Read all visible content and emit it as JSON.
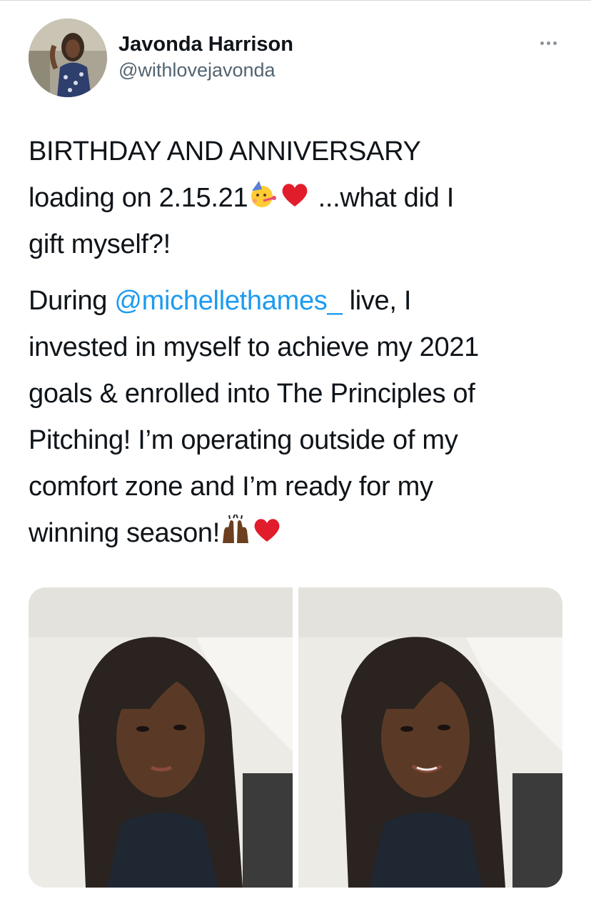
{
  "author": {
    "display_name": "Javonda Harrison",
    "handle": "@withlovejavonda",
    "avatar_icon": "profile-photo"
  },
  "more_icon": "more-options-icon",
  "tweet": {
    "line1": "BIRTHDAY AND ANNIVERSARY",
    "line2_start": "loading on 2.15.21",
    "line2_end": " ...what did I",
    "line3": "gift myself?!",
    "p2_start": "During ",
    "mention": "@michellethames_",
    "p2_after_mention": "  live, I",
    "p2_line2": "invested in myself to achieve my 2021",
    "p2_line3": "goals & enrolled into The Principles of",
    "p2_line4": "Pitching! I’m operating outside of my",
    "p2_line5": "comfort zone and I’m ready for my",
    "p2_line6": "winning season!"
  },
  "emojis": [
    "partying-face-emoji",
    "red-heart-emoji",
    "raising-hands-emoji",
    "red-heart-emoji"
  ],
  "media": [
    {
      "name": "selfie-photo-1"
    },
    {
      "name": "selfie-photo-2"
    }
  ],
  "colors": {
    "link": "#1d9bf0",
    "text": "#0f1419",
    "secondary": "#536471"
  }
}
